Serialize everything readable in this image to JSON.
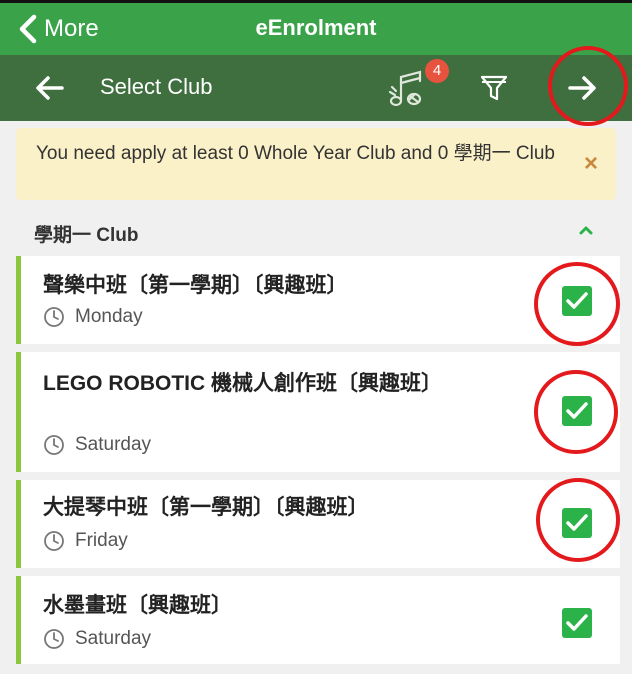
{
  "appbar": {
    "back_label": "More",
    "title": "eEnrolment"
  },
  "toolbar": {
    "title": "Select Club",
    "badge_count": "4"
  },
  "notice": {
    "text": "You need apply at least 0 Whole Year Club and 0 學期一 Club",
    "close_glyph": "×"
  },
  "section": {
    "title": "學期一 Club"
  },
  "clubs": [
    {
      "name": "聲樂中班〔第一學期〕〔興趣班〕",
      "day": "Monday",
      "checked": true
    },
    {
      "name": "LEGO ROBOTIC 機械人創作班〔興趣班〕",
      "day": "Saturday",
      "checked": true
    },
    {
      "name": "大提琴中班〔第一學期〕〔興趣班〕",
      "day": "Friday",
      "checked": true
    },
    {
      "name": "水墨畫班〔興趣班〕",
      "day": "Saturday",
      "checked": true
    }
  ],
  "colors": {
    "appbar": "#3aa34a",
    "toolbar": "#3f6e3f",
    "accent_green": "#2bb34a",
    "row_stripe": "#8cc63f",
    "badge": "#e8533f",
    "annotation_ring": "#e3191c",
    "notice_bg": "#fbf1c9"
  }
}
